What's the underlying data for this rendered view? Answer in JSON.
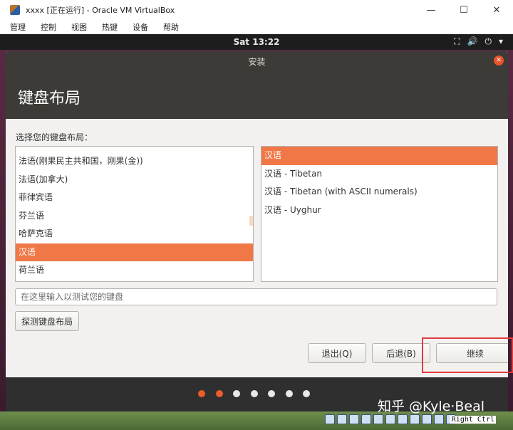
{
  "host_window": {
    "title": "xxxx [正在运行] - Oracle VM VirtualBox",
    "controls": [
      "—",
      "☐",
      "✕"
    ],
    "menus": [
      "管理",
      "控制",
      "视图",
      "热键",
      "设备",
      "帮助"
    ]
  },
  "guest_topbar": {
    "clock": "Sat 13:22",
    "tray_icons": [
      "network-icon",
      "volume-icon",
      "power-icon",
      "chevron-down-icon"
    ],
    "tray_glyphs": [
      "⛶",
      "🔊",
      "⏻",
      "▾"
    ]
  },
  "installer": {
    "window_title": "安装",
    "heading": "键盘布局",
    "prompt": "选择您的键盘布局：",
    "layouts": [
      "法语(刚果民主共和国，刚果(金))",
      "法语(加拿大)",
      "菲律宾语",
      "芬兰语",
      "哈萨克语",
      "汉语",
      "荷兰语"
    ],
    "selected_layout_index": 5,
    "variants": [
      "汉语",
      "汉语 - Tibetan",
      "汉语 - Tibetan (with ASCII numerals)",
      "汉语 - Uyghur"
    ],
    "selected_variant_index": 0,
    "test_input_placeholder": "在这里输入以测试您的键盘",
    "detect_button": "探测键盘布局",
    "quit_button": "退出(Q)",
    "back_button": "后退(B)",
    "continue_button": "继续",
    "progress": {
      "total_steps": 7,
      "completed_steps": 2
    }
  },
  "watermark": "知乎 @Kyle·Beal",
  "statusbar": {
    "host_key": "Right Ctrl"
  },
  "colors": {
    "accent": "#f07746",
    "titlebar": "#3c3b37",
    "highlight_box": "#e03b3b"
  }
}
